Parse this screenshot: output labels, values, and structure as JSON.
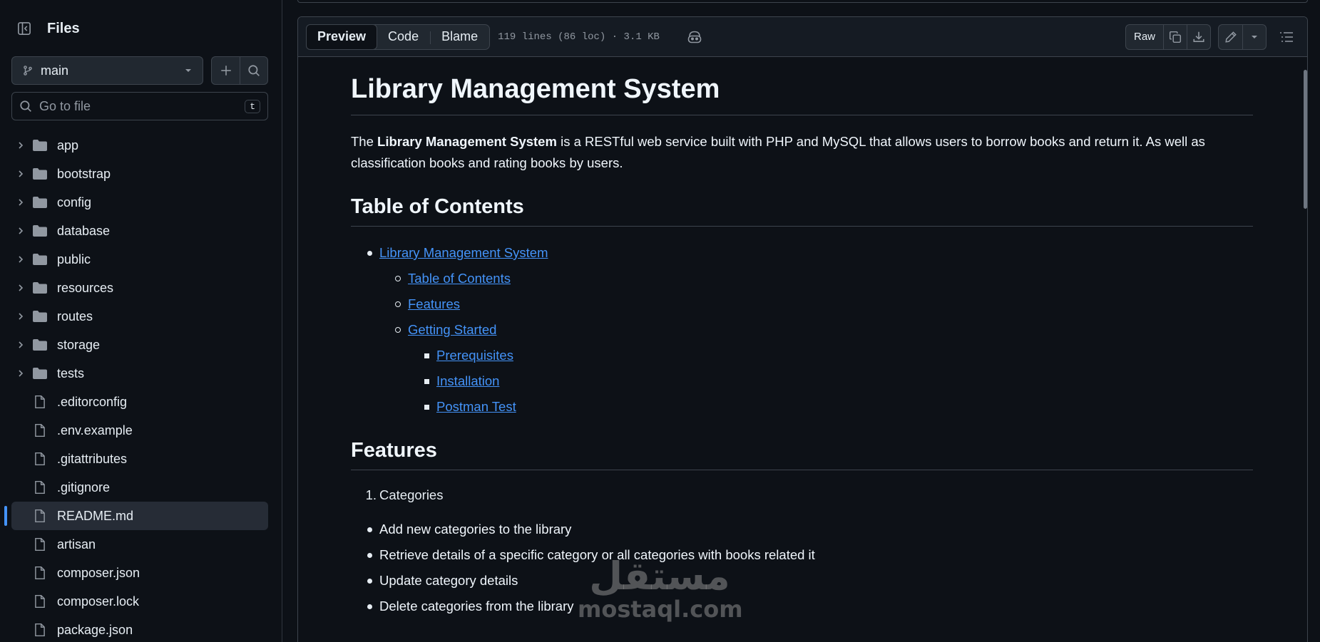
{
  "sidebar": {
    "title": "Files",
    "branch": "main",
    "search": {
      "placeholder": "Go to file",
      "shortcut": "t"
    },
    "items": [
      {
        "name": "app",
        "type": "folder"
      },
      {
        "name": "bootstrap",
        "type": "folder"
      },
      {
        "name": "config",
        "type": "folder"
      },
      {
        "name": "database",
        "type": "folder"
      },
      {
        "name": "public",
        "type": "folder"
      },
      {
        "name": "resources",
        "type": "folder"
      },
      {
        "name": "routes",
        "type": "folder"
      },
      {
        "name": "storage",
        "type": "folder"
      },
      {
        "name": "tests",
        "type": "folder"
      },
      {
        "name": ".editorconfig",
        "type": "file"
      },
      {
        "name": ".env.example",
        "type": "file"
      },
      {
        "name": ".gitattributes",
        "type": "file"
      },
      {
        "name": ".gitignore",
        "type": "file"
      },
      {
        "name": "README.md",
        "type": "file",
        "active": true
      },
      {
        "name": "artisan",
        "type": "file"
      },
      {
        "name": "composer.json",
        "type": "file"
      },
      {
        "name": "composer.lock",
        "type": "file"
      },
      {
        "name": "package.json",
        "type": "file"
      }
    ]
  },
  "toolbar": {
    "tabs": [
      "Preview",
      "Code",
      "Blame"
    ],
    "active_tab": "Preview",
    "meta": "119 lines (86 loc) · 3.1 KB",
    "raw_label": "Raw"
  },
  "readme": {
    "title": "Library Management System",
    "intro_prefix": "The ",
    "intro_bold": "Library Management System",
    "intro_rest": " is a RESTful web service built with PHP and MySQL that allows users to borrow books and return it. As well as classification books and rating books by users.",
    "toc_heading": "Table of Contents",
    "toc": {
      "root": "Library Management System",
      "l2": [
        "Table of Contents",
        "Features",
        "Getting Started"
      ],
      "l3": [
        "Prerequisites",
        "Installation",
        "Postman Test"
      ]
    },
    "features_heading": "Features",
    "ordered_first": {
      "num": "1.",
      "text": "Categories"
    },
    "category_items": [
      "Add new categories to the library",
      "Retrieve details of a specific category or all categories with books related it",
      "Update category details",
      "Delete categories from the library"
    ]
  },
  "watermark": {
    "arabic": "مستقل",
    "latin": "mostaql.com"
  }
}
